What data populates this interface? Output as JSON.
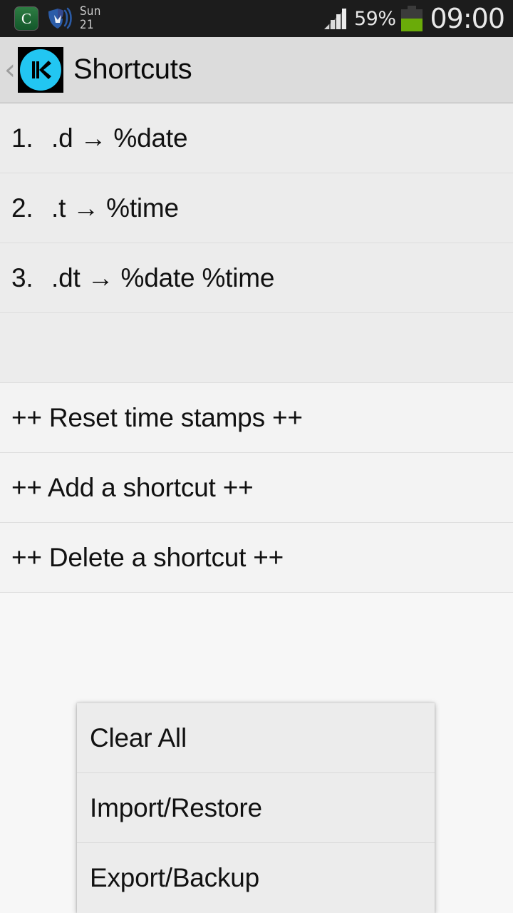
{
  "statusbar": {
    "icons": [
      {
        "name": "clean-master-icon",
        "glyph": "C"
      },
      {
        "name": "malwarebytes-shield-icon"
      }
    ],
    "date_day": "Sun",
    "date_num": "21",
    "signal_bars": 4,
    "battery_percent": "59%",
    "battery_level": 59,
    "clock": "09:00",
    "colors": {
      "background": "#1c1c1c",
      "battery_fill": "#6aab09",
      "text": "#e6e6e6"
    }
  },
  "actionbar": {
    "back_label": "‹",
    "app_icon_name": "kilonotes-k-icon",
    "title": "Shortcuts",
    "colors": {
      "background": "#dcdcdc",
      "logo_disc": "#22c6f2"
    }
  },
  "list": {
    "shortcuts": [
      {
        "index": "1.",
        "text": ".d → %date"
      },
      {
        "index": "2.",
        "text": ".t → %time"
      },
      {
        "index": "3.",
        "text": ".dt → %date %time"
      }
    ],
    "spacer": "",
    "actions": [
      {
        "label": "++ Reset time stamps ++"
      },
      {
        "label": "++ Add a shortcut ++"
      },
      {
        "label": "++ Delete a shortcut ++"
      }
    ]
  },
  "popup_menu": {
    "items": [
      {
        "label": "Clear All"
      },
      {
        "label": "Import/Restore"
      },
      {
        "label": "Export/Backup"
      }
    ]
  }
}
